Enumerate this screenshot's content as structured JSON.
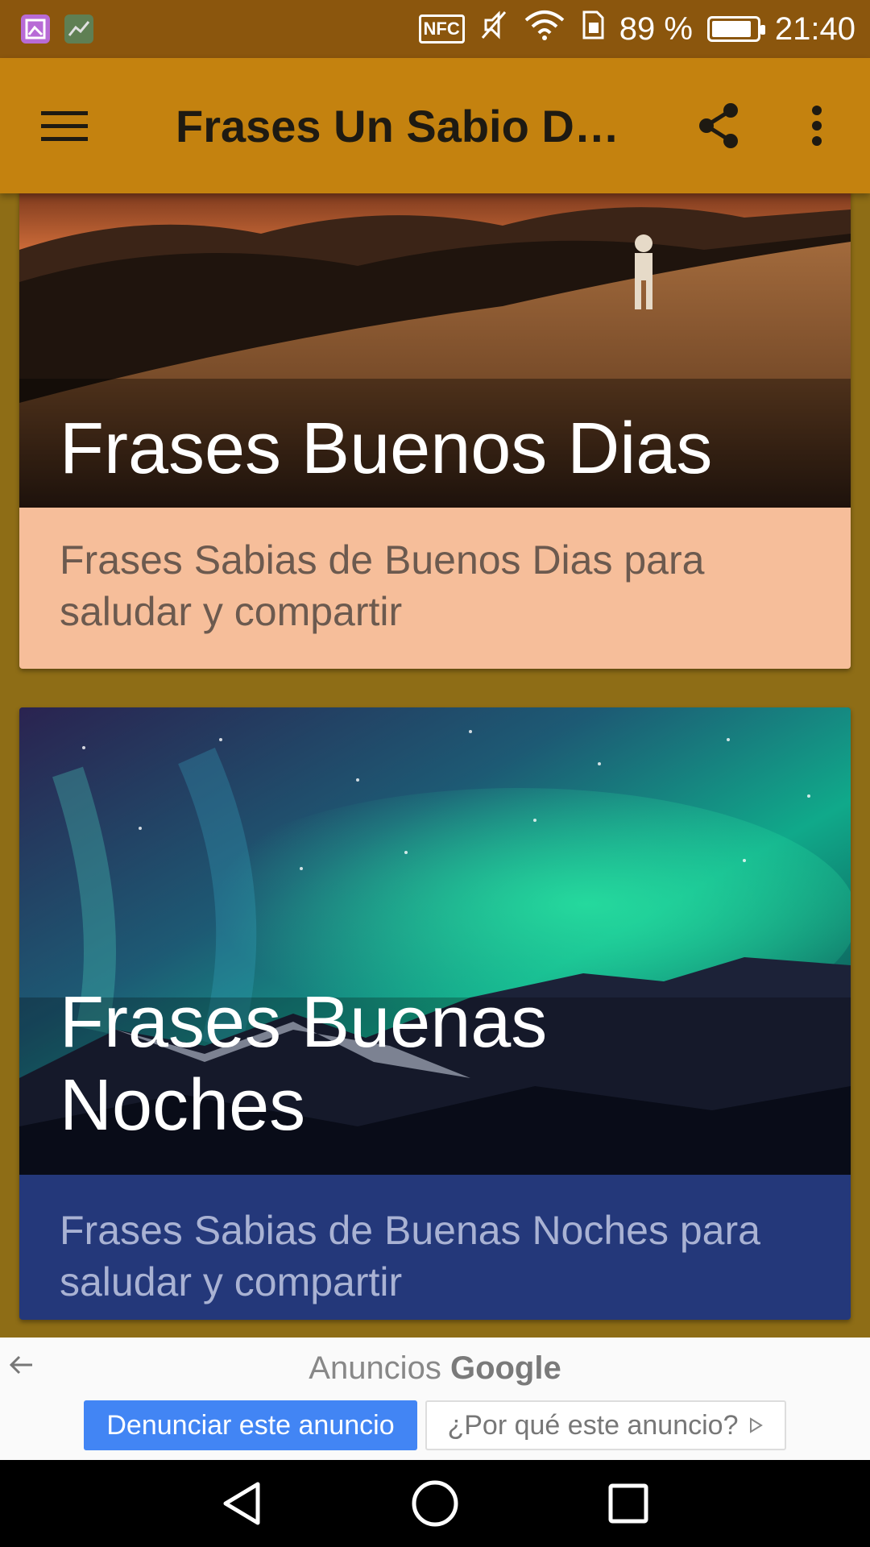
{
  "status_bar": {
    "nfc_label": "NFC",
    "battery_percent": "89 %",
    "battery_level": 0.89,
    "time": "21:40",
    "icons": [
      "gallery-icon",
      "chart-icon",
      "nfc-icon",
      "mute-icon",
      "wifi-icon",
      "sim-icon",
      "battery-icon"
    ]
  },
  "app_bar": {
    "title": "Frases Un Sabio Dijo",
    "menu_icon": "hamburger-menu-icon",
    "share_icon": "share-icon",
    "more_icon": "more-vert-icon",
    "color": "#c4820f"
  },
  "cards": [
    {
      "title": "Frases Buenos Dias",
      "description": "Frases Sabias de Buenos Dias para saludar y compartir",
      "image": "sunrise-hiker-landscape",
      "footer_color": "#f6be9a"
    },
    {
      "title": "Frases Buenas Noches",
      "description": "Frases Sabias de Buenas Noches para saludar y compartir",
      "image": "aurora-mountains-night",
      "footer_color": "#24387a"
    }
  ],
  "ad": {
    "label": "Anuncios",
    "brand": "Google",
    "report_button": "Denunciar este anuncio",
    "why_button": "¿Por qué este anuncio?",
    "back_icon": "arrow-back-icon",
    "why_icon": "adchoices-icon"
  },
  "nav_bar": {
    "icons": [
      "nav-back-icon",
      "nav-home-icon",
      "nav-recents-icon"
    ]
  }
}
